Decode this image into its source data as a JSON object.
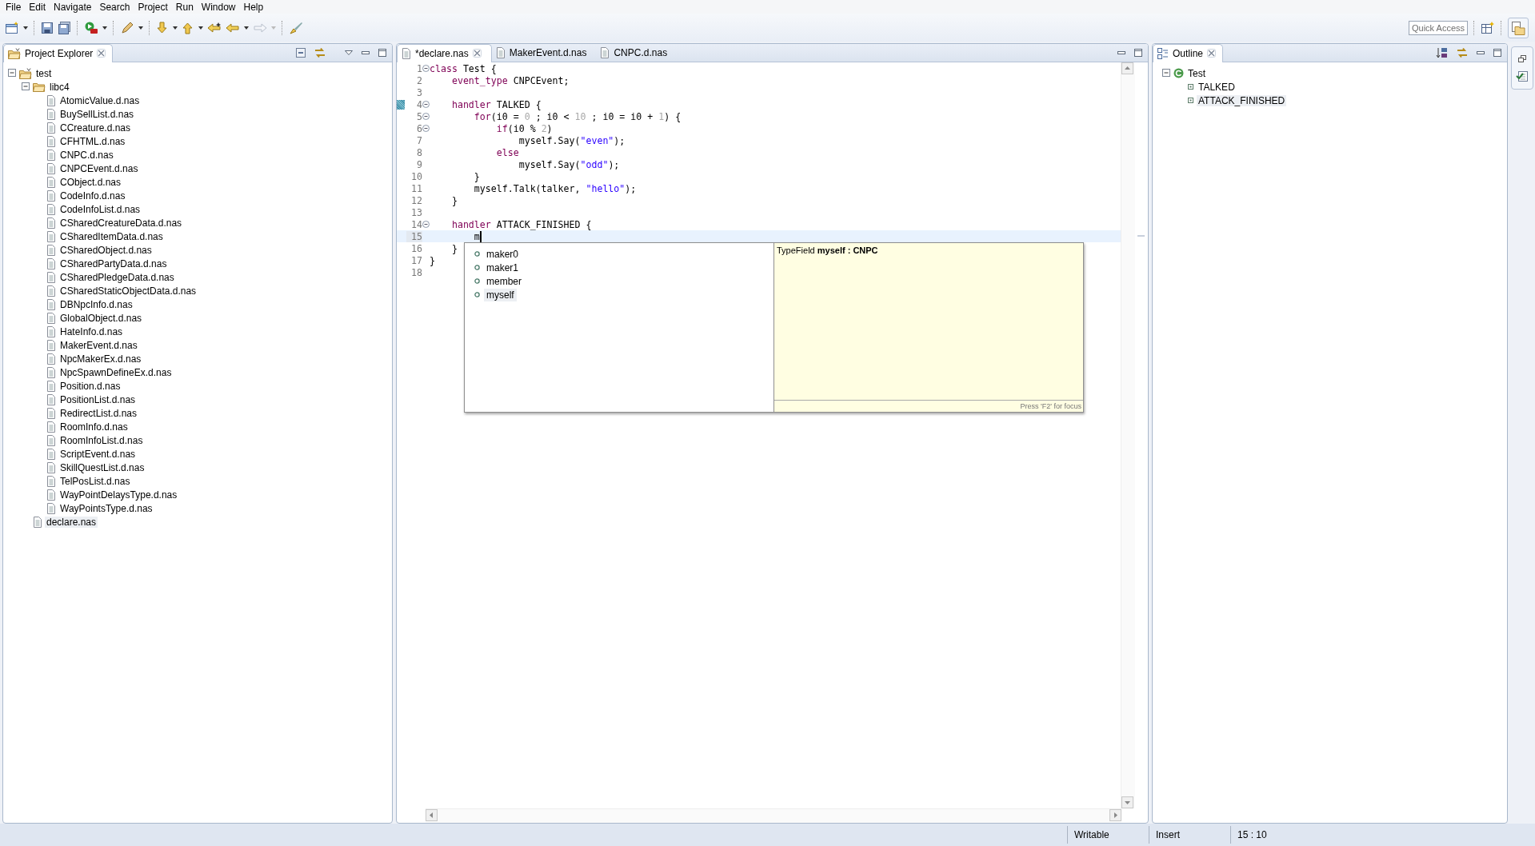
{
  "menu": [
    "File",
    "Edit",
    "Navigate",
    "Search",
    "Project",
    "Run",
    "Window",
    "Help"
  ],
  "quick_access": {
    "placeholder": "Quick Access"
  },
  "explorer": {
    "title": "Project Explorer",
    "tree": [
      {
        "label": "test",
        "kind": "project",
        "expanded": true,
        "selected": false,
        "children": [
          {
            "label": "libc4",
            "kind": "folder",
            "expanded": true,
            "selected": false,
            "children": [
              {
                "label": "AtomicValue.d.nas",
                "kind": "file",
                "selected": false
              },
              {
                "label": "BuySellList.d.nas",
                "kind": "file",
                "selected": false
              },
              {
                "label": "CCreature.d.nas",
                "kind": "file",
                "selected": false
              },
              {
                "label": "CFHTML.d.nas",
                "kind": "file",
                "selected": false
              },
              {
                "label": "CNPC.d.nas",
                "kind": "file",
                "selected": false
              },
              {
                "label": "CNPCEvent.d.nas",
                "kind": "file",
                "selected": false
              },
              {
                "label": "CObject.d.nas",
                "kind": "file",
                "selected": false
              },
              {
                "label": "CodeInfo.d.nas",
                "kind": "file",
                "selected": false
              },
              {
                "label": "CodeInfoList.d.nas",
                "kind": "file",
                "selected": false
              },
              {
                "label": "CSharedCreatureData.d.nas",
                "kind": "file",
                "selected": false
              },
              {
                "label": "CSharedItemData.d.nas",
                "kind": "file",
                "selected": false
              },
              {
                "label": "CSharedObject.d.nas",
                "kind": "file",
                "selected": false
              },
              {
                "label": "CSharedPartyData.d.nas",
                "kind": "file",
                "selected": false
              },
              {
                "label": "CSharedPledgeData.d.nas",
                "kind": "file",
                "selected": false
              },
              {
                "label": "CSharedStaticObjectData.d.nas",
                "kind": "file",
                "selected": false
              },
              {
                "label": "DBNpcInfo.d.nas",
                "kind": "file",
                "selected": false
              },
              {
                "label": "GlobalObject.d.nas",
                "kind": "file",
                "selected": false
              },
              {
                "label": "HateInfo.d.nas",
                "kind": "file",
                "selected": false
              },
              {
                "label": "MakerEvent.d.nas",
                "kind": "file",
                "selected": false
              },
              {
                "label": "NpcMakerEx.d.nas",
                "kind": "file",
                "selected": false
              },
              {
                "label": "NpcSpawnDefineEx.d.nas",
                "kind": "file",
                "selected": false
              },
              {
                "label": "Position.d.nas",
                "kind": "file",
                "selected": false
              },
              {
                "label": "PositionList.d.nas",
                "kind": "file",
                "selected": false
              },
              {
                "label": "RedirectList.d.nas",
                "kind": "file",
                "selected": false
              },
              {
                "label": "RoomInfo.d.nas",
                "kind": "file",
                "selected": false
              },
              {
                "label": "RoomInfoList.d.nas",
                "kind": "file",
                "selected": false
              },
              {
                "label": "ScriptEvent.d.nas",
                "kind": "file",
                "selected": false
              },
              {
                "label": "SkillQuestList.d.nas",
                "kind": "file",
                "selected": false
              },
              {
                "label": "TelPosList.d.nas",
                "kind": "file",
                "selected": false
              },
              {
                "label": "WayPointDelaysType.d.nas",
                "kind": "file",
                "selected": false
              },
              {
                "label": "WayPointsType.d.nas",
                "kind": "file",
                "selected": false
              }
            ]
          },
          {
            "label": "declare.nas",
            "kind": "file",
            "selected": true
          }
        ]
      }
    ]
  },
  "editor": {
    "tabs": [
      {
        "label": "*declare.nas",
        "selected": true
      },
      {
        "label": "MakerEvent.d.nas",
        "selected": false
      },
      {
        "label": "CNPC.d.nas",
        "selected": false
      }
    ],
    "lines": [
      {
        "number": "1",
        "fold": true,
        "bookmark": false,
        "current": false,
        "tokens": [
          {
            "text": "class",
            "kind": "keyword"
          },
          {
            "text": " Test {",
            "kind": "plain"
          }
        ]
      },
      {
        "number": "2",
        "fold": false,
        "bookmark": false,
        "current": false,
        "tokens": [
          {
            "text": "    event_type",
            "kind": "keyword"
          },
          {
            "text": " CNPCEvent;",
            "kind": "plain"
          }
        ]
      },
      {
        "number": "3",
        "fold": false,
        "bookmark": false,
        "current": false
      },
      {
        "number": "4",
        "fold": true,
        "bookmark": true,
        "current": false,
        "tokens": [
          {
            "text": "    handler",
            "kind": "keyword"
          },
          {
            "text": " TALKED {",
            "kind": "plain"
          }
        ]
      },
      {
        "number": "5",
        "fold": true,
        "bookmark": false,
        "current": false,
        "tokens": [
          {
            "text": "        for",
            "kind": "keyword"
          },
          {
            "text": "(i0 = ",
            "kind": "plain"
          },
          {
            "text": "0",
            "kind": "number"
          },
          {
            "text": " ; i0 < ",
            "kind": "plain"
          },
          {
            "text": "10",
            "kind": "number"
          },
          {
            "text": " ; i0 = i0 + ",
            "kind": "plain"
          },
          {
            "text": "1",
            "kind": "number"
          },
          {
            "text": ") {",
            "kind": "plain"
          }
        ]
      },
      {
        "number": "6",
        "fold": true,
        "bookmark": false,
        "current": false,
        "tokens": [
          {
            "text": "            if",
            "kind": "keyword"
          },
          {
            "text": "(i0 % ",
            "kind": "plain"
          },
          {
            "text": "2",
            "kind": "number"
          },
          {
            "text": ")",
            "kind": "plain"
          }
        ]
      },
      {
        "number": "7",
        "fold": false,
        "bookmark": false,
        "current": false,
        "tokens": [
          {
            "text": "                myself.Say(",
            "kind": "plain"
          },
          {
            "text": "\"even\"",
            "kind": "string"
          },
          {
            "text": ");",
            "kind": "plain"
          }
        ]
      },
      {
        "number": "8",
        "fold": false,
        "bookmark": false,
        "current": false,
        "tokens": [
          {
            "text": "            else",
            "kind": "keyword"
          }
        ]
      },
      {
        "number": "9",
        "fold": false,
        "bookmark": false,
        "current": false,
        "tokens": [
          {
            "text": "                myself.Say(",
            "kind": "plain"
          },
          {
            "text": "\"odd\"",
            "kind": "string"
          },
          {
            "text": ");",
            "kind": "plain"
          }
        ]
      },
      {
        "number": "10",
        "fold": false,
        "bookmark": false,
        "current": false,
        "tokens": [
          {
            "text": "        }",
            "kind": "plain"
          }
        ]
      },
      {
        "number": "11",
        "fold": false,
        "bookmark": false,
        "current": false,
        "tokens": [
          {
            "text": "        myself.Talk(talker, ",
            "kind": "plain"
          },
          {
            "text": "\"hello\"",
            "kind": "string"
          },
          {
            "text": ");",
            "kind": "plain"
          }
        ]
      },
      {
        "number": "12",
        "fold": false,
        "bookmark": false,
        "current": false,
        "tokens": [
          {
            "text": "    }",
            "kind": "plain"
          }
        ]
      },
      {
        "number": "13",
        "fold": false,
        "bookmark": false,
        "current": false
      },
      {
        "number": "14",
        "fold": true,
        "bookmark": false,
        "current": false,
        "tokens": [
          {
            "text": "    handler",
            "kind": "keyword"
          },
          {
            "text": " ATTACK_FINISHED {",
            "kind": "plain"
          }
        ]
      },
      {
        "number": "15",
        "fold": false,
        "bookmark": false,
        "current": true,
        "tokens": [
          {
            "text": "        m",
            "kind": "plain"
          }
        ]
      },
      {
        "number": "16",
        "fold": false,
        "bookmark": false,
        "current": false,
        "tokens": [
          {
            "text": "    }",
            "kind": "plain"
          }
        ]
      },
      {
        "number": "17",
        "fold": false,
        "bookmark": false,
        "current": false,
        "tokens": [
          {
            "text": "}",
            "kind": "plain"
          }
        ]
      },
      {
        "number": "18",
        "fold": false,
        "bookmark": false,
        "current": false
      }
    ],
    "completion": {
      "items": [
        {
          "label": "maker0",
          "selected": false
        },
        {
          "label": "maker1",
          "selected": false
        },
        {
          "label": "member",
          "selected": false
        },
        {
          "label": "myself",
          "selected": true
        }
      ],
      "info": "TypeField **myself : CNPC**",
      "hint": "Press 'F2' for focus"
    }
  },
  "outline": {
    "title": "Outline",
    "tree": [
      {
        "label": "Test",
        "kind": "class",
        "expanded": true,
        "selected": false,
        "children": [
          {
            "label": "TALKED",
            "kind": "method",
            "selected": false
          },
          {
            "label": "ATTACK_FINISHED",
            "kind": "method",
            "selected": true
          }
        ]
      }
    ]
  },
  "status_bar": [
    "Writable",
    "Insert",
    "15 : 10"
  ]
}
